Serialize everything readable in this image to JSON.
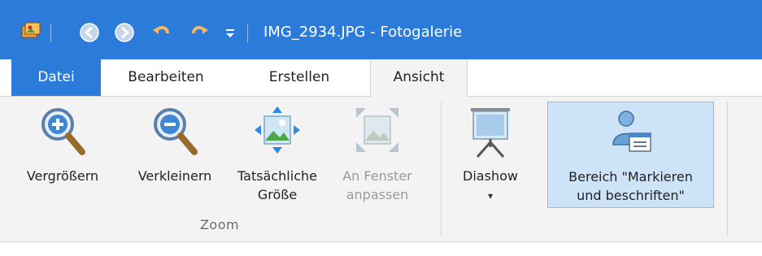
{
  "window": {
    "title": "IMG_2934.JPG - Fotogalerie",
    "accent": "#2b7bdb",
    "quick_access_icons": [
      "app-photo-icon",
      "back-icon",
      "forward-icon",
      "undo-icon",
      "redo-icon",
      "customize-toolbar-icon"
    ]
  },
  "tabs": [
    {
      "label": "Datei"
    },
    {
      "label": "Bearbeiten"
    },
    {
      "label": "Erstellen"
    },
    {
      "label": "Ansicht"
    }
  ],
  "ribbon": {
    "zoom_group_label": "Zoom",
    "buttons": {
      "zoom_in": {
        "label": "Vergrößern",
        "icon": "zoom-in-icon"
      },
      "zoom_out": {
        "label": "Verkleinern",
        "icon": "zoom-out-icon"
      },
      "actual_size": {
        "line1": "Tatsächliche",
        "line2": "Größe",
        "icon": "actual-size-icon"
      },
      "fit_window": {
        "line1": "An Fenster",
        "line2": "anpassen",
        "icon": "fit-to-window-icon",
        "disabled": true
      },
      "slideshow": {
        "label": "Diashow",
        "caret": "▾",
        "icon": "slideshow-icon"
      },
      "tag_pane": {
        "line1": "Bereich \"Markieren",
        "line2": "und beschriften\"",
        "icon": "tag-pane-icon",
        "active": true
      }
    }
  }
}
